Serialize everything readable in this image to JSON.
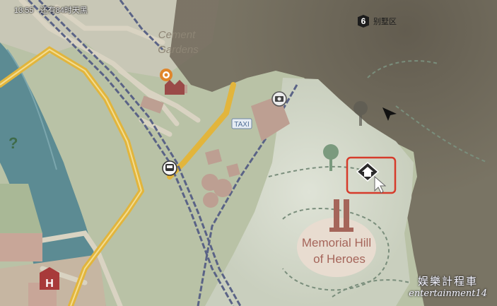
{
  "hud": {
    "time": "13:55",
    "status": "还有84时天黑"
  },
  "district": {
    "number": "6",
    "name": "别墅区"
  },
  "labels": {
    "area_name": "Cement Gardens",
    "landmark_line1": "Memorial Hill",
    "landmark_line2": "of Heroes",
    "taxi": "TAXI",
    "hospital": "H"
  },
  "watermark": {
    "chinese": "娱樂計程車",
    "english": "entertainment14"
  },
  "icons": {
    "objective": "orange-target-icon",
    "factory": "factory-icon",
    "camera": "camera-icon",
    "bus": "bus-stop-icon",
    "safehouse": "safehouse-icon",
    "cursor": "arrow-cursor-icon",
    "hospital": "hospital-icon",
    "tree": "tree-icon",
    "monument": "monument-icon",
    "question": "question-icon"
  },
  "colors": {
    "grass": "#b9c2a6",
    "road": "#d9d3c2",
    "main_road": "#e2b53c",
    "water": "#5c8b93",
    "rail": "#5a6386",
    "building": "#bd9f92",
    "fog": "#6e6658",
    "highlight_box": "#d63b2b",
    "objective": "#e0862a",
    "hospital": "#a83a3a"
  }
}
